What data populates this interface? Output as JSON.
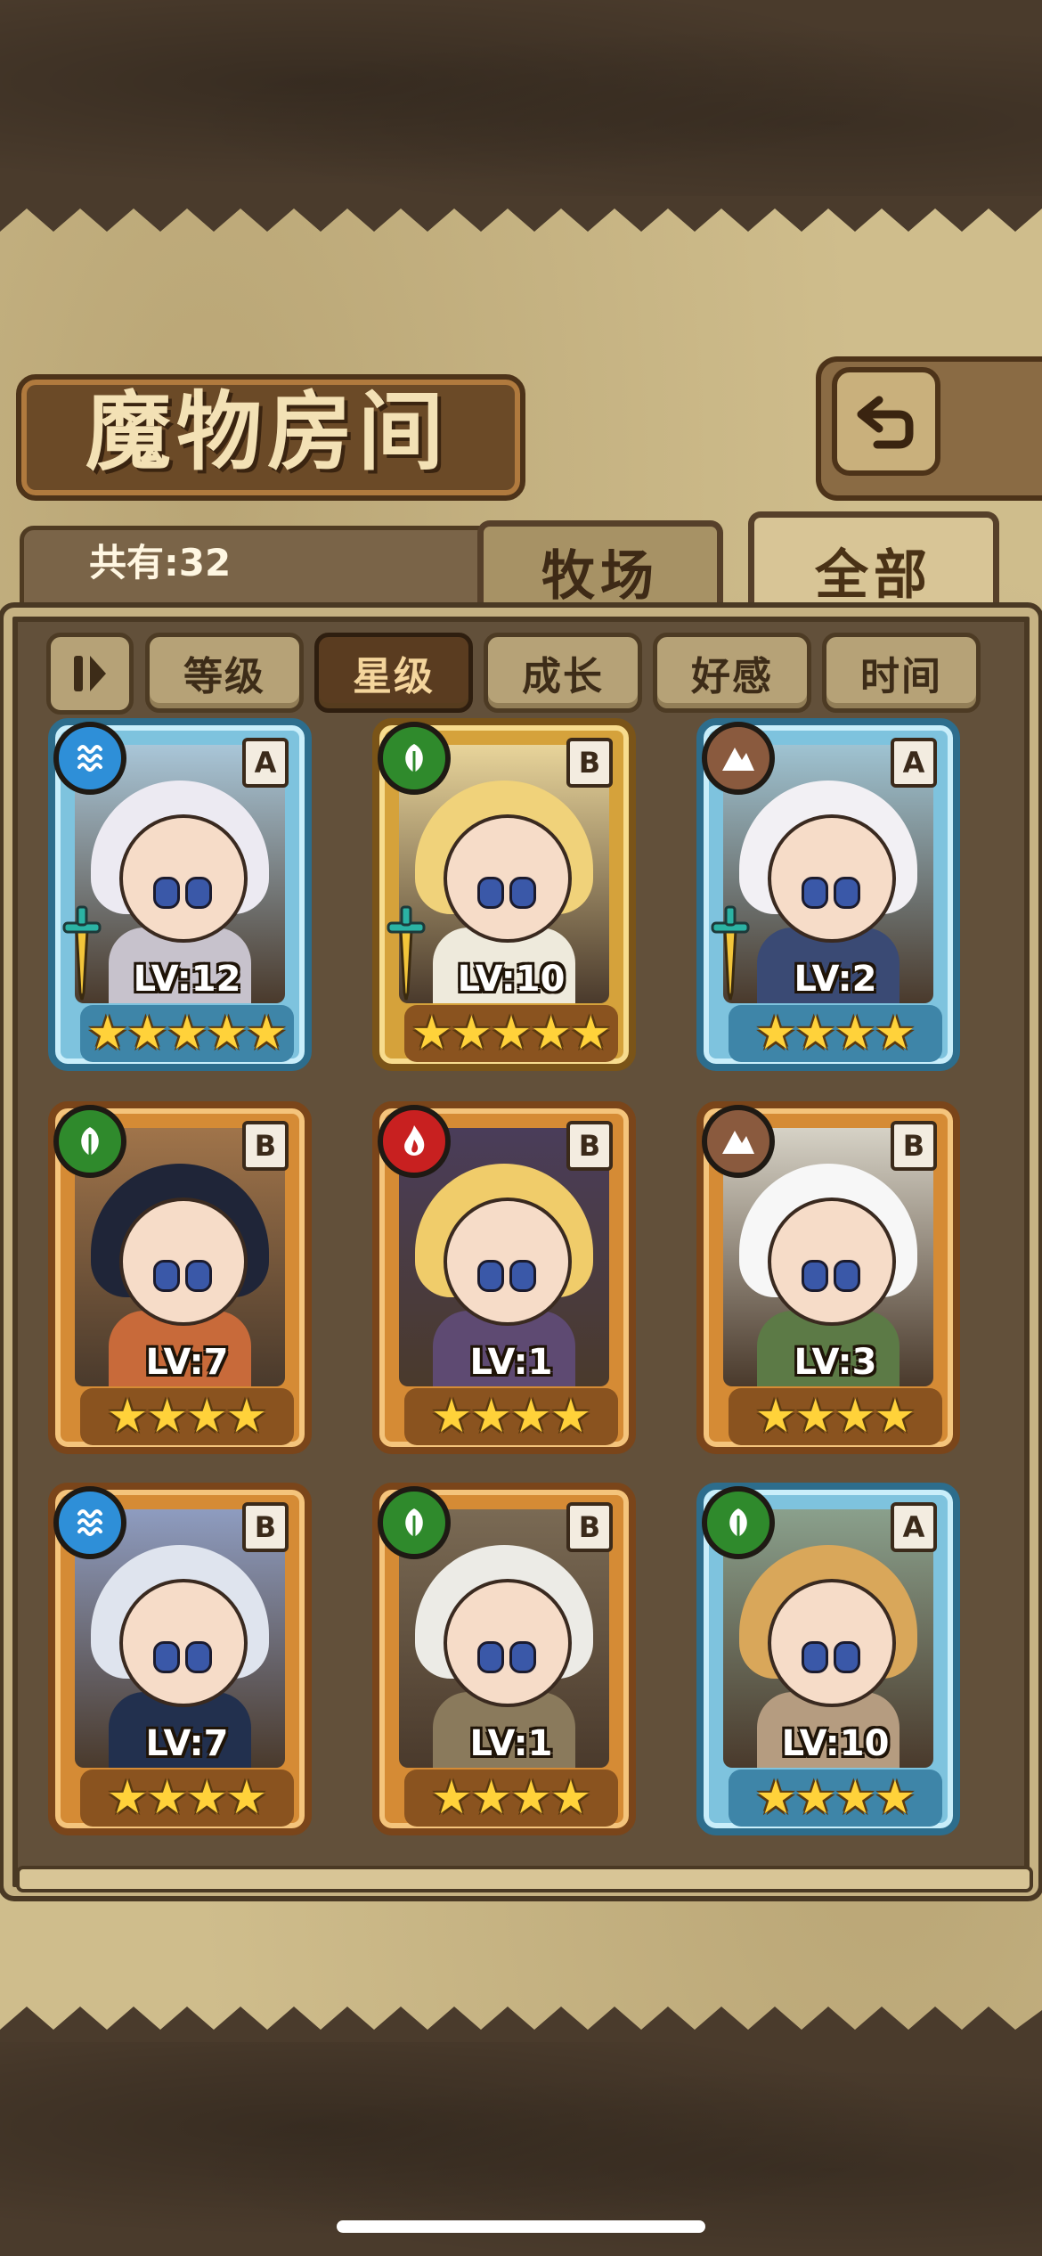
{
  "header": {
    "title": "魔物房间",
    "back_icon": "return-arrow-icon"
  },
  "summary": {
    "count_text": "共有:32"
  },
  "tabs": [
    {
      "label": "牧场",
      "active": false
    },
    {
      "label": "全部",
      "active": true
    }
  ],
  "sort_buttons": [
    {
      "label": "等级",
      "active": false
    },
    {
      "label": "星级",
      "active": true
    },
    {
      "label": "成长",
      "active": false
    },
    {
      "label": "好感",
      "active": false
    },
    {
      "label": "时间",
      "active": false
    }
  ],
  "monsters": [
    {
      "level": "LV:12",
      "rank": "A",
      "element": "water",
      "stars": 5,
      "weapon": true
    },
    {
      "level": "LV:10",
      "rank": "B",
      "element": "grass",
      "stars": 5,
      "weapon": true
    },
    {
      "level": "LV:2",
      "rank": "A",
      "element": "earth",
      "stars": 4,
      "weapon": true
    },
    {
      "level": "LV:7",
      "rank": "B",
      "element": "grass",
      "stars": 4,
      "weapon": false
    },
    {
      "level": "LV:1",
      "rank": "B",
      "element": "fire",
      "stars": 4,
      "weapon": false
    },
    {
      "level": "LV:3",
      "rank": "B",
      "element": "earth",
      "stars": 4,
      "weapon": false
    },
    {
      "level": "LV:7",
      "rank": "B",
      "element": "water",
      "stars": 4,
      "weapon": false
    },
    {
      "level": "LV:1",
      "rank": "B",
      "element": "grass",
      "stars": 4,
      "weapon": false
    },
    {
      "level": "LV:10",
      "rank": "A",
      "element": "grass",
      "stars": 4,
      "weapon": false
    }
  ],
  "colors": {
    "rank_A_frame": "#7ec3de",
    "rank_B_frame": "#d58b35",
    "gold_frame": "#d5a23b",
    "star": "#ffd23a",
    "water": "#2e8fd8",
    "grass": "#2f8a2c",
    "earth": "#8a5a3e",
    "fire": "#c82020"
  }
}
